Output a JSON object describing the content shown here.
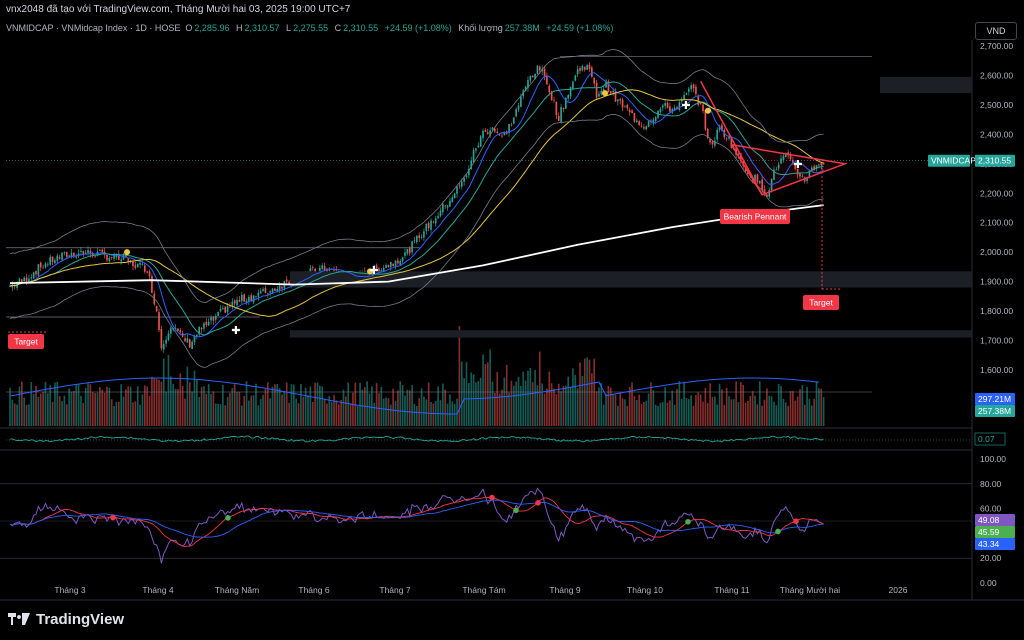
{
  "caption": "vnx2048 đã tạo với TradingView.com, Tháng Mười hai 03, 2025 19:00 UTC+7",
  "legend": {
    "symbol": "VNMIDCAP · VNMidcap Index · 1D · HOSE",
    "open_k": "O",
    "open": "2,285.96",
    "high_k": "H",
    "high": "2,310.57",
    "low_k": "L",
    "low": "2,275.55",
    "close_k": "C",
    "close": "2,310.55",
    "change": "+24.59 (+1.08%)",
    "volume_k": "Khối lượng",
    "volume": "257.38M",
    "volume_change": "+24.59 (+1.08%)"
  },
  "currency": "VND",
  "brand": "TradingView",
  "colors": {
    "up": "#26a69a",
    "down": "#ef5350",
    "pennant": "#f23645",
    "ma200": "#ffffff",
    "ma_yellow": "#e5c43e",
    "ma_blue": "#2962ff"
  },
  "badges": {
    "symbol_tag": "VNMIDCAP",
    "last_price": "2,310.55",
    "vol_ma": "297.21M",
    "vol": "257.38M",
    "osc": "0.07",
    "rsi_a": "49.08",
    "rsi_b": "45.59",
    "rsi_c": "43.34"
  },
  "annotations": {
    "pennant": "Bearish Pennant",
    "target_right": "Target",
    "target_left": "Target"
  },
  "chart_data": {
    "type": "candlestick",
    "price_axis": {
      "ticks": [
        2700,
        2600,
        2500,
        2400,
        2300,
        2200,
        2100,
        2000,
        1900,
        1800,
        1700,
        1600
      ],
      "tick_labels": [
        "2,700.00",
        "2,600.00",
        "2,500.00",
        "2,400.00",
        "2,300.00",
        "2,200.00",
        "2,100.00",
        "2,000.00",
        "1,900.00",
        "1,800.00",
        "1,700.00",
        "1,600.00"
      ],
      "range": [
        1550,
        2740
      ]
    },
    "rsi_axis": {
      "ticks": [
        100,
        80,
        60,
        40,
        20,
        0
      ],
      "tick_labels": [
        "100.00",
        "80.00",
        "60.00",
        "40.00",
        "20.00",
        "0.00"
      ],
      "range": [
        0,
        110
      ]
    },
    "time_axis": [
      "Tháng 3",
      "Tháng 4",
      "Tháng Năm",
      "Tháng 6",
      "Tháng 7",
      "Tháng Tám",
      "Tháng 9",
      "Tháng 10",
      "Tháng 11",
      "Tháng Mười hai",
      "2026"
    ],
    "close_path": [
      [
        0,
        1885
      ],
      [
        6,
        1905
      ],
      [
        12,
        1945
      ],
      [
        18,
        1975
      ],
      [
        24,
        1990
      ],
      [
        30,
        2000
      ],
      [
        36,
        1995
      ],
      [
        42,
        1985
      ],
      [
        48,
        1975
      ],
      [
        52,
        1960
      ],
      [
        58,
        1945
      ],
      [
        62,
        1800
      ],
      [
        64,
        1680
      ],
      [
        68,
        1755
      ],
      [
        72,
        1715
      ],
      [
        76,
        1690
      ],
      [
        80,
        1735
      ],
      [
        86,
        1770
      ],
      [
        92,
        1815
      ],
      [
        98,
        1840
      ],
      [
        104,
        1855
      ],
      [
        110,
        1870
      ],
      [
        116,
        1895
      ],
      [
        122,
        1920
      ],
      [
        128,
        1935
      ],
      [
        134,
        1945
      ],
      [
        140,
        1925
      ],
      [
        146,
        1905
      ],
      [
        152,
        1935
      ],
      [
        156,
        1945
      ],
      [
        162,
        1965
      ],
      [
        168,
        2000
      ],
      [
        174,
        2065
      ],
      [
        180,
        2120
      ],
      [
        186,
        2180
      ],
      [
        192,
        2245
      ],
      [
        196,
        2335
      ],
      [
        200,
        2405
      ],
      [
        204,
        2425
      ],
      [
        208,
        2385
      ],
      [
        212,
        2440
      ],
      [
        216,
        2520
      ],
      [
        220,
        2600
      ],
      [
        224,
        2625
      ],
      [
        228,
        2555
      ],
      [
        232,
        2455
      ],
      [
        236,
        2545
      ],
      [
        240,
        2615
      ],
      [
        244,
        2640
      ],
      [
        248,
        2535
      ],
      [
        252,
        2570
      ],
      [
        256,
        2520
      ],
      [
        260,
        2490
      ],
      [
        264,
        2455
      ],
      [
        268,
        2430
      ],
      [
        272,
        2460
      ],
      [
        276,
        2495
      ],
      [
        280,
        2485
      ],
      [
        284,
        2510
      ],
      [
        288,
        2560
      ],
      [
        292,
        2500
      ],
      [
        296,
        2360
      ],
      [
        300,
        2420
      ],
      [
        304,
        2385
      ],
      [
        308,
        2320
      ],
      [
        312,
        2275
      ],
      [
        316,
        2240
      ],
      [
        320,
        2200
      ],
      [
        324,
        2290
      ],
      [
        328,
        2330
      ],
      [
        332,
        2275
      ],
      [
        336,
        2250
      ],
      [
        340,
        2290
      ],
      [
        344,
        2310
      ]
    ],
    "bars_total": 345,
    "ma200_path": [
      [
        0,
        1895
      ],
      [
        60,
        1905
      ],
      [
        120,
        1890
      ],
      [
        160,
        1900
      ],
      [
        200,
        1955
      ],
      [
        240,
        2025
      ],
      [
        280,
        2085
      ],
      [
        320,
        2135
      ],
      [
        344,
        2160
      ]
    ],
    "pennant": {
      "pole_top": 2580,
      "pole_bottom": 2195,
      "apex": 2300
    },
    "target_level": 1875,
    "series": [
      {
        "name": "VNMIDCAP",
        "last": 2310.55
      },
      {
        "name": "Khối lượng",
        "last": 257.38,
        "ma": 297.21
      }
    ],
    "grid": false,
    "legend_position": "top-left"
  }
}
